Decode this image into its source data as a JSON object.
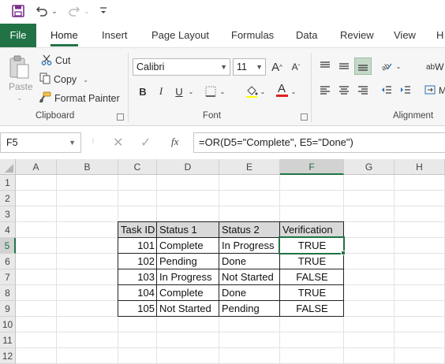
{
  "qat": {
    "save_icon": "save-icon",
    "undo_icon": "undo-icon",
    "redo_icon": "redo-icon",
    "customize_icon": "customize-icon"
  },
  "tabs": [
    "File",
    "Home",
    "Insert",
    "Page Layout",
    "Formulas",
    "Data",
    "Review",
    "View",
    "H"
  ],
  "ribbon": {
    "clipboard": {
      "paste": "Paste",
      "cut": "Cut",
      "copy": "Copy",
      "format_painter": "Format Painter",
      "label": "Clipboard"
    },
    "font": {
      "name": "Calibri",
      "size": "11",
      "bold": "B",
      "italic": "I",
      "underline": "U",
      "label": "Font",
      "font_color": "#e02020"
    },
    "alignment": {
      "label": "Alignment",
      "wrap_prefix": "ab",
      "wrap_letter": "W",
      "merge_letter": "M"
    }
  },
  "formula_bar": {
    "name_box": "F5",
    "fx": "fx",
    "formula": "=OR(D5=\"Complete\", E5=\"Done\")"
  },
  "sheet": {
    "columns": [
      "A",
      "B",
      "C",
      "D",
      "E",
      "F",
      "G",
      "H"
    ],
    "rows": [
      "1",
      "2",
      "3",
      "4",
      "5",
      "6",
      "7",
      "8",
      "9",
      "10",
      "11",
      "12"
    ],
    "headers": [
      "Task ID",
      "Status 1",
      "Status 2",
      "Verification"
    ],
    "data": [
      [
        "101",
        "Complete",
        "In Progress",
        "TRUE"
      ],
      [
        "102",
        "Pending",
        "Done",
        "TRUE"
      ],
      [
        "103",
        "In Progress",
        "Not Started",
        "FALSE"
      ],
      [
        "104",
        "Complete",
        "Done",
        "TRUE"
      ],
      [
        "105",
        "Not Started",
        "Pending",
        "FALSE"
      ]
    ],
    "selected_cell": "F5",
    "accent": "#217346"
  }
}
